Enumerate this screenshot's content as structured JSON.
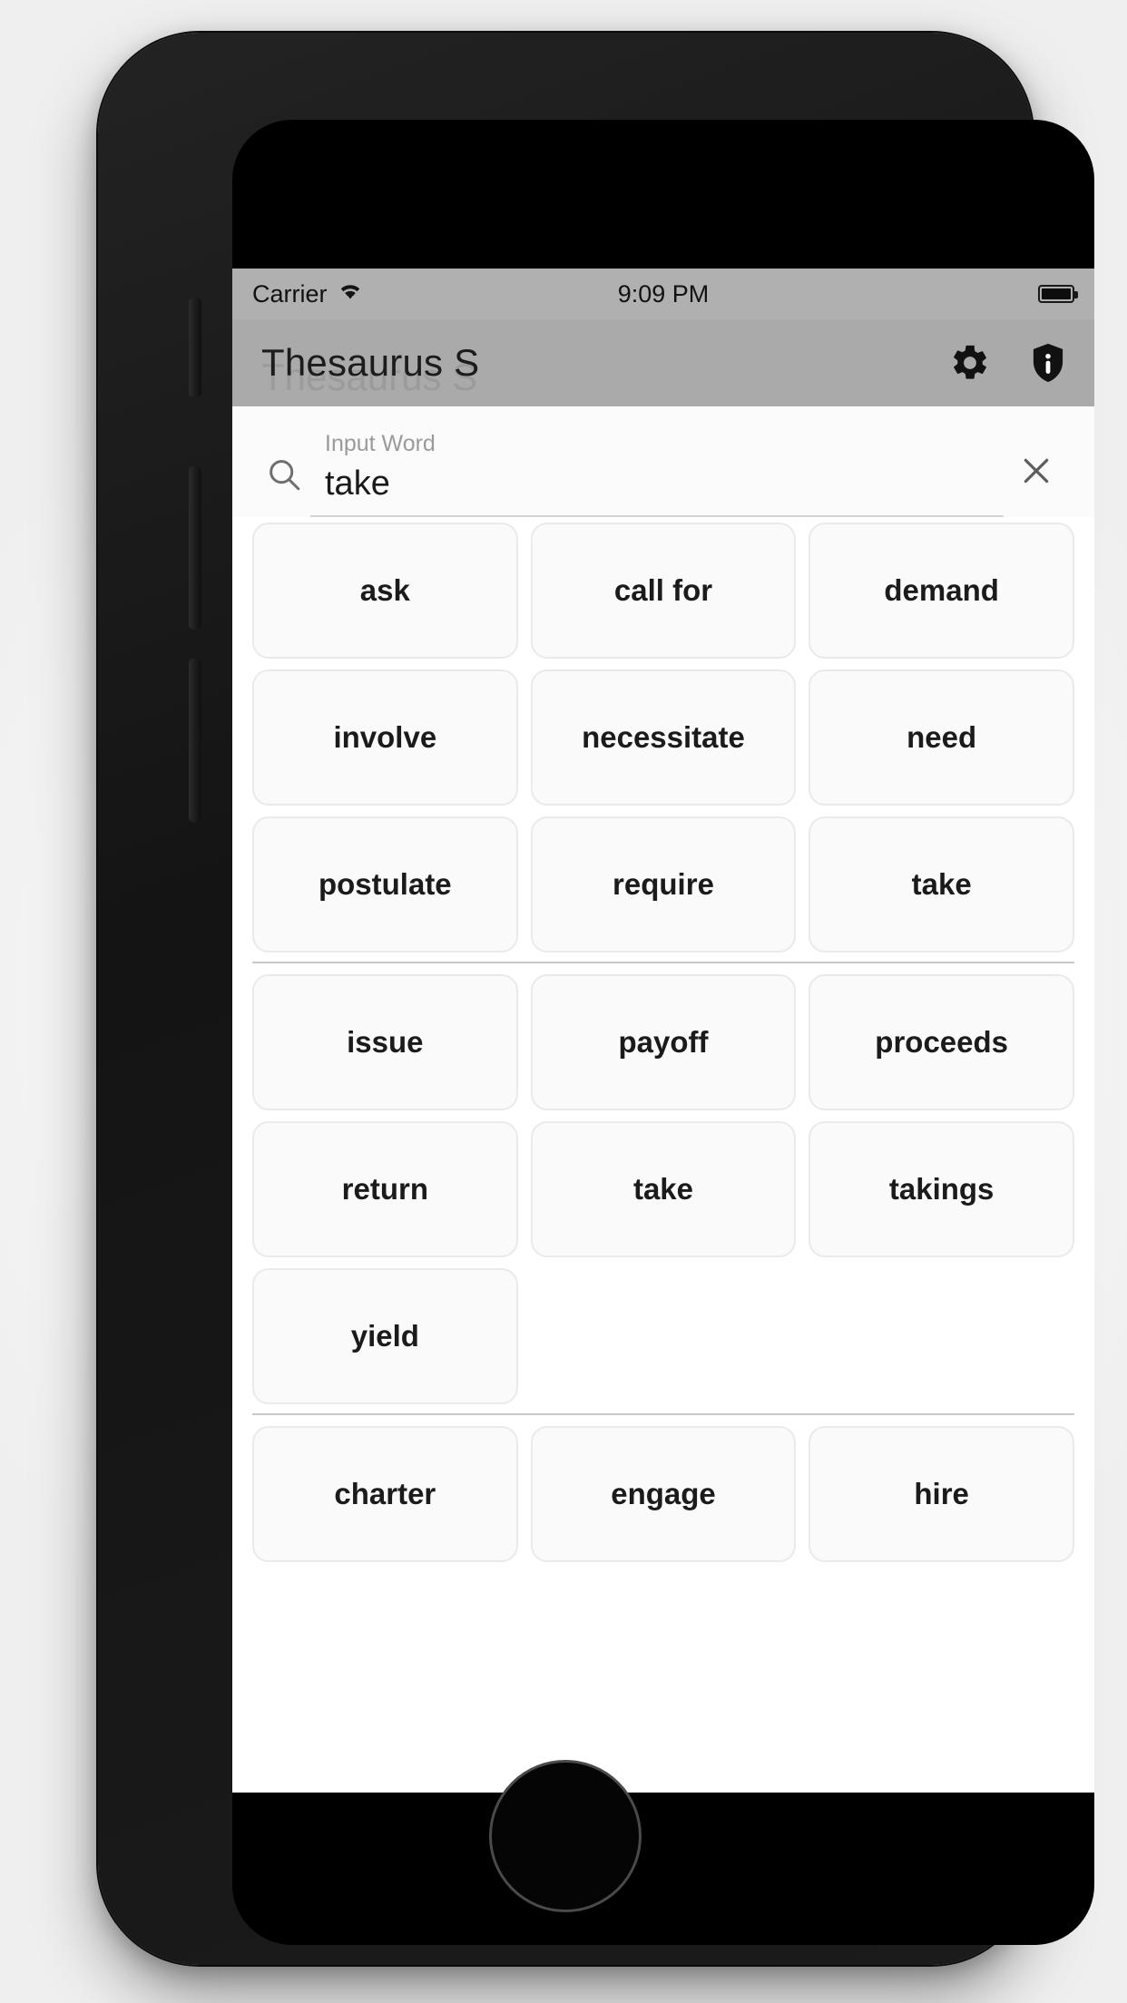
{
  "status_bar": {
    "carrier": "Carrier",
    "wifi_icon": "wifi-icon",
    "time": "9:09 PM",
    "battery_icon": "battery-full-icon"
  },
  "nav_bar": {
    "title": "Thesaurus S",
    "title_ghost": "Thesaurus S",
    "settings_icon": "gear-icon",
    "info_icon": "shield-info-icon"
  },
  "search": {
    "search_icon": "search-icon",
    "label": "Input Word",
    "value": "take",
    "placeholder": "Input Word",
    "clear_icon": "close-icon"
  },
  "colors": {
    "status_bar_bg": "#b0b0b0",
    "nav_bar_bg": "#aaaaaa",
    "chip_bg": "#fafafa",
    "chip_border": "#eaeaea",
    "divider": "#c9c9c9",
    "text": "#1b1b1b",
    "muted_text": "#9a9a9a"
  },
  "results": {
    "groups": [
      {
        "id": "group-1",
        "rows": [
          [
            "ask",
            "call for",
            "demand"
          ],
          [
            "involve",
            "necessitate",
            "need"
          ],
          [
            "postulate",
            "require",
            "take"
          ]
        ]
      },
      {
        "id": "group-2",
        "rows": [
          [
            "issue",
            "payoff",
            "proceeds"
          ],
          [
            "return",
            "take",
            "takings"
          ],
          [
            "yield",
            "",
            ""
          ]
        ]
      },
      {
        "id": "group-3",
        "rows": [
          [
            "charter",
            "engage",
            "hire"
          ],
          [
            "",
            "",
            ""
          ]
        ]
      }
    ]
  }
}
